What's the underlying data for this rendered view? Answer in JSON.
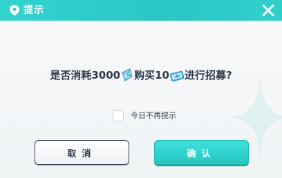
{
  "dialog": {
    "title": "提示",
    "title_icon": "location-pin-icon",
    "close_icon": "close-icon",
    "question": {
      "part1": "是否消耗3000",
      "part2": "购买10",
      "part3": "进行招募?",
      "currency_icon": "crystal-gem-icon",
      "ticket_icon": "recruit-ticket-icon"
    },
    "checkbox": {
      "label": "今日不再提示",
      "checked": false
    },
    "cancel_label": "取消",
    "confirm_label": "确认"
  },
  "colors": {
    "accent": "#2fcfcb",
    "text": "#2f3b4b",
    "cancel_border": "#2f3a52"
  }
}
